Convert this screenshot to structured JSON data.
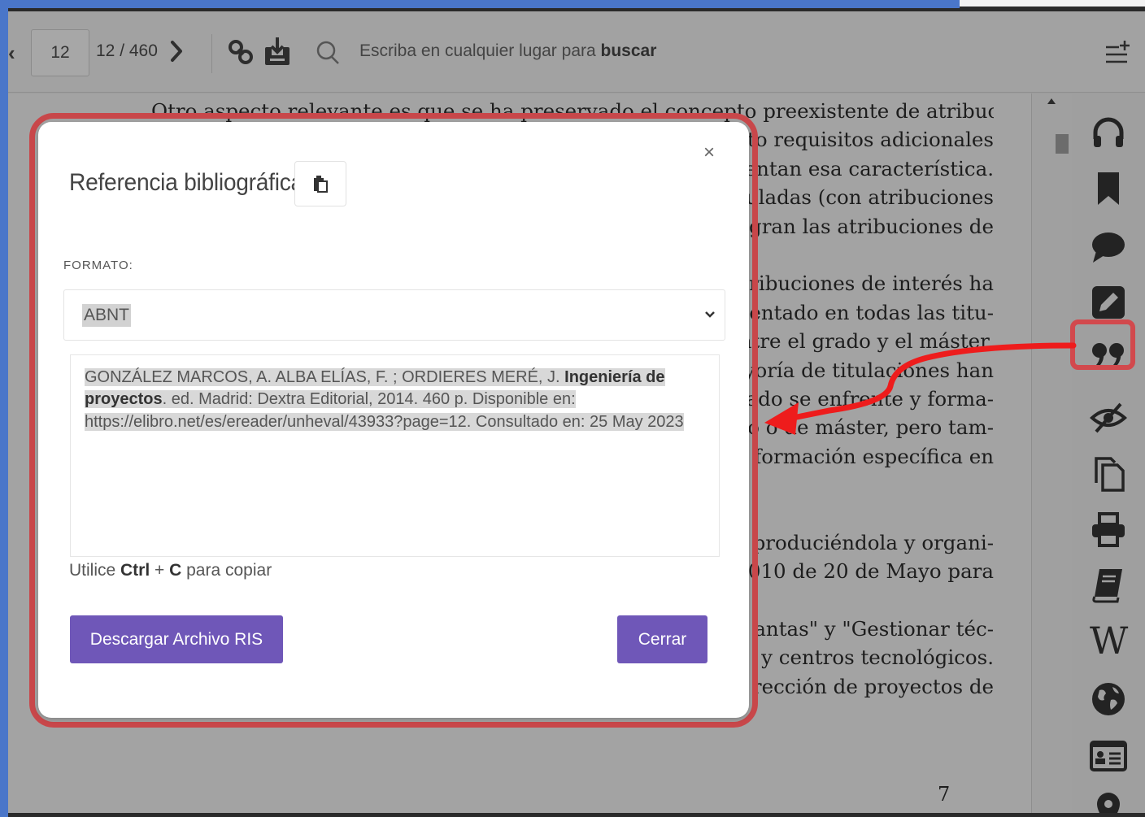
{
  "toolbar": {
    "page_input_value": "12",
    "page_count": "12 / 460",
    "search_placeholder_prefix": "Escriba en cualquier lugar para ",
    "search_placeholder_bold": "buscar"
  },
  "document": {
    "lines": [
      "Otro aspecto relevante es que se ha preservado el concepto preexistente de atribución profe-",
      "esto requisitos adicionales",
      "esentan esa característica.",
      "guladas (con atribuciones",
      "tegran las atribuciones de",
      "",
      "atribuciones de interés ha",
      "mentado en todas las titu-",
      "entre el grado y el máster.",
      "ayoría de titulaciones han",
      "esado se enfrente y forma-",
      "ado o de máster, pero tam-",
      "a formación específica en",
      "",
      "",
      "produciéndola y organi-",
      "010 de 20 de Mayo para",
      "",
      "antas\" y \"Gestionar téc-",
      "y centros tecnológicos.",
      "rección de proyectos de"
    ],
    "page_number": "7"
  },
  "sidebar": {
    "icons": [
      "headphones-icon",
      "bookmark-icon",
      "comment-icon",
      "edit-icon",
      "quote-icon",
      "hide-eye-icon",
      "copy-pages-icon",
      "print-icon",
      "book-icon",
      "wikipedia-icon",
      "globe-icon",
      "id-card-icon",
      "location-pin-icon"
    ],
    "wikipedia_letter": "W"
  },
  "modal": {
    "title": "Referencia bibliográfica",
    "close_symbol": "×",
    "format_label": "FORMATO:",
    "format_value": "ABNT",
    "reference": {
      "authors": "GONZÁLEZ MARCOS, A. ALBA ELÍAS, F. ; ORDIERES MERÉ, J. ",
      "title": "Ingeniería de proyectos",
      "details": ". ed. Madrid: Dextra Editorial, 2014. 460 p. Disponible en: https://elibro.net/es/ereader/unheval/43933?page=12. Consultado en: 25 May 2023"
    },
    "copy_hint": {
      "prefix": "Utilice ",
      "key1": "Ctrl",
      "plus": " + ",
      "key2": "C",
      "suffix": " para copiar"
    },
    "download_button": "Descargar Archivo RIS",
    "close_button": "Cerrar"
  },
  "colors": {
    "accent_purple": "#6f57b8",
    "annotation_red": "#d2494d",
    "frame_blue": "#4a76c9"
  }
}
